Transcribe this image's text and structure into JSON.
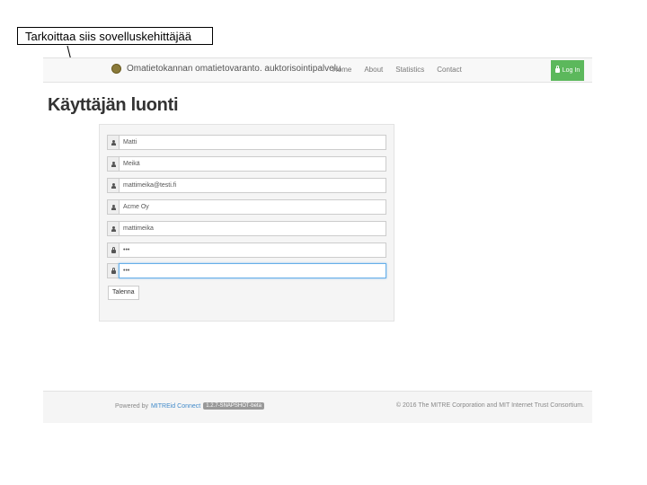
{
  "annotation": {
    "text": "Tarkoittaa siis sovelluskehittäjää"
  },
  "navbar": {
    "brand": "Omatietokannan omatietovaranto. auktorisointipalvelu",
    "links": [
      "Home",
      "About",
      "Statistics",
      "Contact"
    ],
    "login_label": "Log In"
  },
  "page": {
    "title": "Käyttäjän luonti"
  },
  "form": {
    "fields": [
      {
        "icon": "user-icon",
        "value": "Matti"
      },
      {
        "icon": "user-icon",
        "value": "Meikä"
      },
      {
        "icon": "user-icon",
        "value": "mattimeika@testi.fi"
      },
      {
        "icon": "user-icon",
        "value": "Acme Oy"
      },
      {
        "icon": "user-icon",
        "value": "mattimeika"
      },
      {
        "icon": "lock-icon",
        "value": "•••"
      },
      {
        "icon": "lock-icon",
        "value": "•••"
      }
    ],
    "submit_label": "Talenna"
  },
  "footer": {
    "powered_prefix": "Powered by",
    "powered_link": "MITREid Connect",
    "version": "1.2.7-SNAPSHOT-beta",
    "copyright": "© 2016 The MITRE Corporation and MIT Internet Trust Consortium."
  }
}
